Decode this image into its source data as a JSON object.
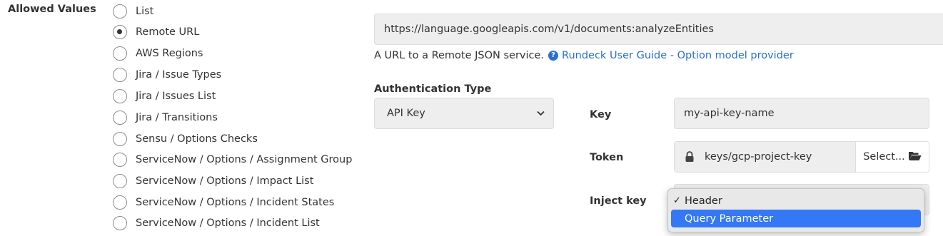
{
  "allowed_values": {
    "label": "Allowed Values",
    "options": [
      {
        "label": "List",
        "checked": false
      },
      {
        "label": "Remote URL",
        "checked": true
      },
      {
        "label": "AWS Regions",
        "checked": false
      },
      {
        "label": "Jira / Issue Types",
        "checked": false
      },
      {
        "label": "Jira / Issues List",
        "checked": false
      },
      {
        "label": "Jira / Transitions",
        "checked": false
      },
      {
        "label": "Sensu / Options Checks",
        "checked": false
      },
      {
        "label": "ServiceNow / Options / Assignment Group",
        "checked": false
      },
      {
        "label": "ServiceNow / Options / Impact List",
        "checked": false
      },
      {
        "label": "ServiceNow / Options / Incident States",
        "checked": false
      },
      {
        "label": "ServiceNow / Options / Incident List",
        "checked": false
      }
    ]
  },
  "remote_url": {
    "value": "https://language.googleapis.com/v1/documents:analyzeEntities",
    "help_text": "A URL to a Remote JSON service.",
    "help_icon": "question-circle-icon",
    "help_link": "Rundeck User Guide - Option model provider"
  },
  "auth": {
    "label": "Authentication Type",
    "selected": "API Key"
  },
  "key": {
    "label": "Key",
    "value": "my-api-key-name"
  },
  "token": {
    "label": "Token",
    "value": "keys/gcp-project-key",
    "lock_icon": "lock-icon",
    "select_button": "Select...",
    "folder_icon": "folder-open-icon"
  },
  "inject_key": {
    "label": "Inject key",
    "options": [
      {
        "label": "Header",
        "checked": true
      },
      {
        "label": "Query Parameter",
        "highlighted": true
      }
    ]
  },
  "colors": {
    "link": "#2a6fd6",
    "highlight": "#3478f6",
    "field_bg": "#eeeeee"
  }
}
